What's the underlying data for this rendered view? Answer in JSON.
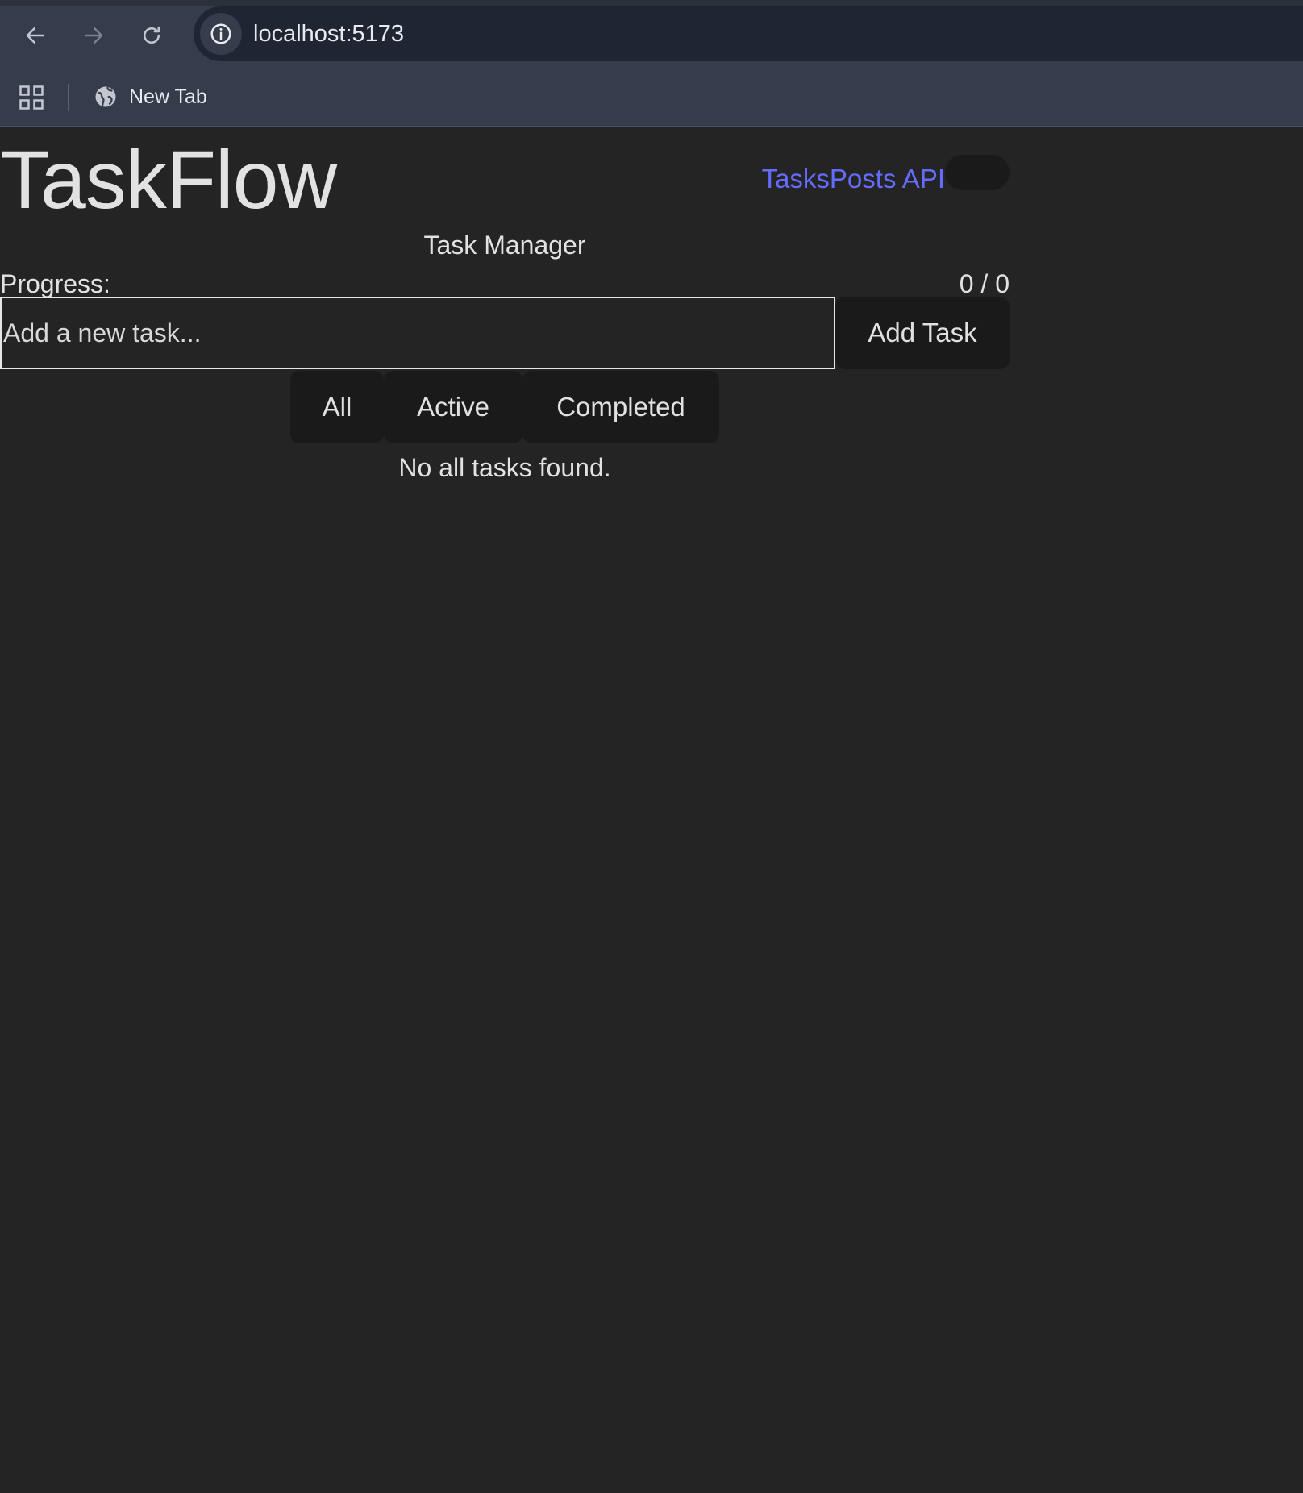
{
  "browser": {
    "url": "localhost:5173",
    "bookmarks": [
      {
        "label": "New Tab"
      }
    ],
    "icons": {
      "back": "arrow-left-icon",
      "forward": "arrow-right-icon",
      "reload": "reload-icon",
      "site_info": "info-icon",
      "apps": "apps-grid-icon",
      "bookmark": "globe-icon"
    }
  },
  "app": {
    "title": "TaskFlow",
    "nav": {
      "tasks_label": "Tasks",
      "posts_api_label": "Posts API"
    },
    "subtitle": "Task Manager",
    "progress": {
      "label": "Progress:",
      "value": "0 / 0",
      "completed": 0,
      "total": 0
    },
    "new_task": {
      "placeholder": "Add a new task...",
      "value": "",
      "button_label": "Add Task"
    },
    "filters": [
      {
        "label": "All",
        "selected": true
      },
      {
        "label": "Active",
        "selected": false
      },
      {
        "label": "Completed",
        "selected": false
      }
    ],
    "empty_message": "No all tasks found."
  },
  "colors": {
    "page_background": "#242424",
    "link": "#646cff",
    "button_background": "#1a1a1a",
    "chrome_background": "#353c4b",
    "urlbar_background": "#1f2533"
  }
}
